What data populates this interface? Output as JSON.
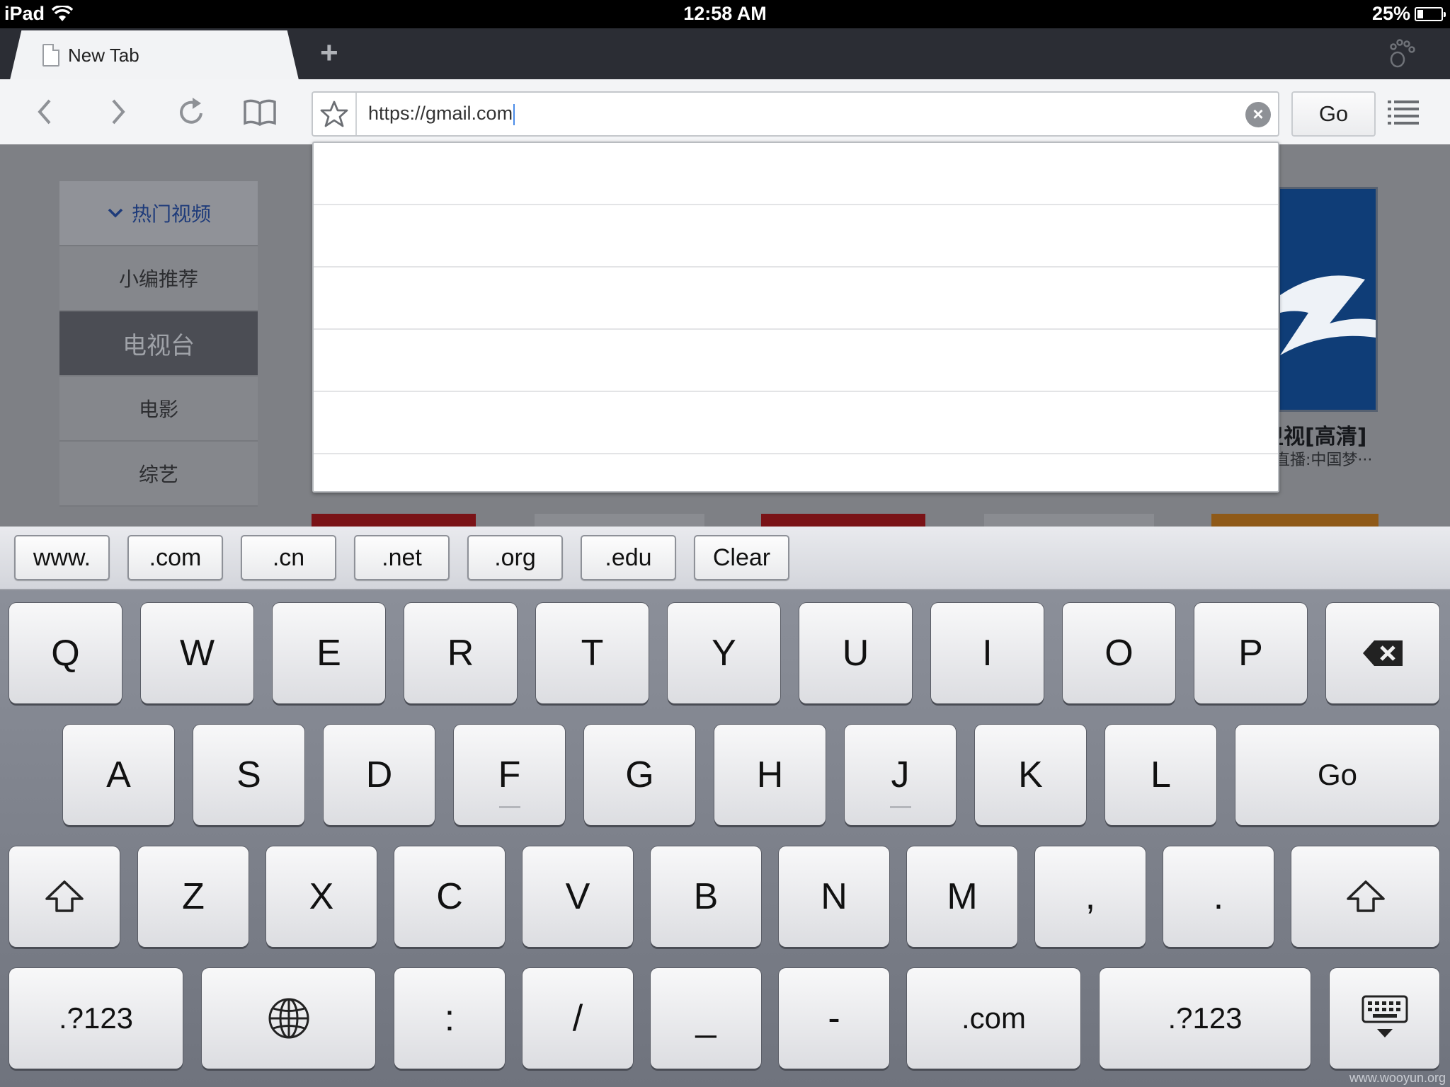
{
  "status_bar": {
    "device": "iPad",
    "time": "12:58 AM",
    "battery_percent": "25%",
    "battery_level": 0.25
  },
  "tab_strip": {
    "tabs": [
      {
        "title": "New Tab",
        "active": true
      }
    ],
    "new_tab_icon": "plus-icon",
    "logo_icon": "paw-icon"
  },
  "address_bar": {
    "url": "https://gmail.com",
    "go_label": "Go",
    "icons": [
      "back-icon",
      "forward-icon",
      "reload-icon",
      "bookmarks-icon",
      "star-icon",
      "clear-icon",
      "menu-icon"
    ]
  },
  "suggestions": {
    "rows": [
      "",
      "",
      "",
      "",
      "",
      ""
    ]
  },
  "page": {
    "side_menu": [
      "热门视频",
      "小编推荐",
      "电视台",
      "电影",
      "综艺"
    ],
    "side_menu_active": "电视台",
    "thumb_caption": "卫视[高清]",
    "thumb_subcaption": "直播:中国梦···",
    "colors": {
      "thumb_blue": "#0f3d77",
      "red_block": "#7a1317",
      "orange_block": "#8f5a18"
    }
  },
  "keyboard": {
    "shortcuts": [
      "www.",
      ".com",
      ".cn",
      ".net",
      ".org",
      ".edu",
      "Clear"
    ],
    "row1": [
      "Q",
      "W",
      "E",
      "R",
      "T",
      "Y",
      "U",
      "I",
      "O",
      "P"
    ],
    "row2": [
      "A",
      "S",
      "D",
      "F",
      "G",
      "H",
      "J",
      "K",
      "L"
    ],
    "row2_action": "Go",
    "row3": [
      "Z",
      "X",
      "C",
      "V",
      "B",
      "N",
      "M",
      ",",
      "."
    ],
    "row4": {
      "numbers_left": ".?123",
      "colon": ":",
      "slash": "/",
      "underscore": "_",
      "dash": "-",
      "dotcom": ".com",
      "numbers_right": ".?123"
    },
    "icons": [
      "backspace-icon",
      "shift-left-icon",
      "shift-right-icon",
      "globe-icon",
      "hide-keyboard-icon"
    ]
  },
  "watermark": "www.wooyun.org"
}
